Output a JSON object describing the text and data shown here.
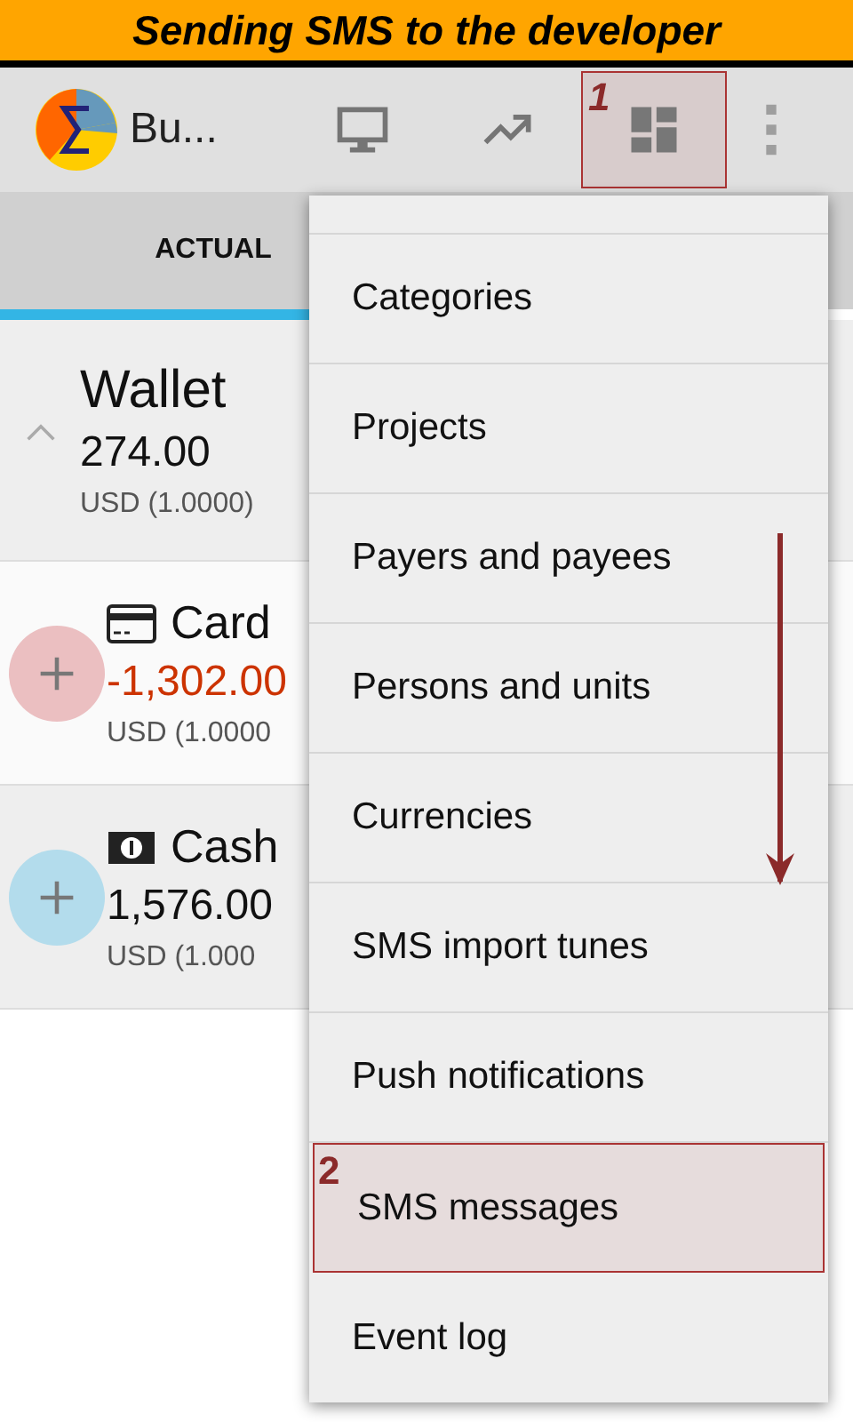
{
  "banner": {
    "text": "Sending SMS to the developer"
  },
  "app_bar": {
    "title": "Bu...",
    "actions": [
      {
        "kind": "monitor",
        "highlighted": false
      },
      {
        "kind": "trend",
        "highlighted": false
      },
      {
        "kind": "dashboard",
        "highlighted": true,
        "annotation": "1"
      },
      {
        "kind": "more",
        "highlighted": false
      }
    ]
  },
  "tabs": [
    {
      "label": "ACTUAL",
      "selected": true
    }
  ],
  "accounts": [
    {
      "kind": "group",
      "name": "Wallet",
      "amount": "274.00",
      "currency": "USD (1.0000)",
      "negative": false,
      "expanded": true
    },
    {
      "kind": "card",
      "name": "Card",
      "amount": "-1,302.00",
      "currency": "USD (1.0000",
      "negative": true,
      "color": "#ebbfc1"
    },
    {
      "kind": "cash",
      "name": "Cash",
      "amount": "1,576.00",
      "currency": "USD (1.000",
      "negative": false,
      "color": "#b3dcec"
    }
  ],
  "menu": {
    "items": [
      {
        "label": "Categories",
        "highlighted": false
      },
      {
        "label": "Projects",
        "highlighted": false
      },
      {
        "label": "Payers and payees",
        "highlighted": false
      },
      {
        "label": "Persons and units",
        "highlighted": false
      },
      {
        "label": "Currencies",
        "highlighted": false
      },
      {
        "label": "SMS import tunes",
        "highlighted": false
      },
      {
        "label": "Push notifications",
        "highlighted": false
      },
      {
        "label": "SMS messages",
        "highlighted": true,
        "annotation": "2"
      },
      {
        "label": "Event log",
        "highlighted": false
      }
    ]
  }
}
